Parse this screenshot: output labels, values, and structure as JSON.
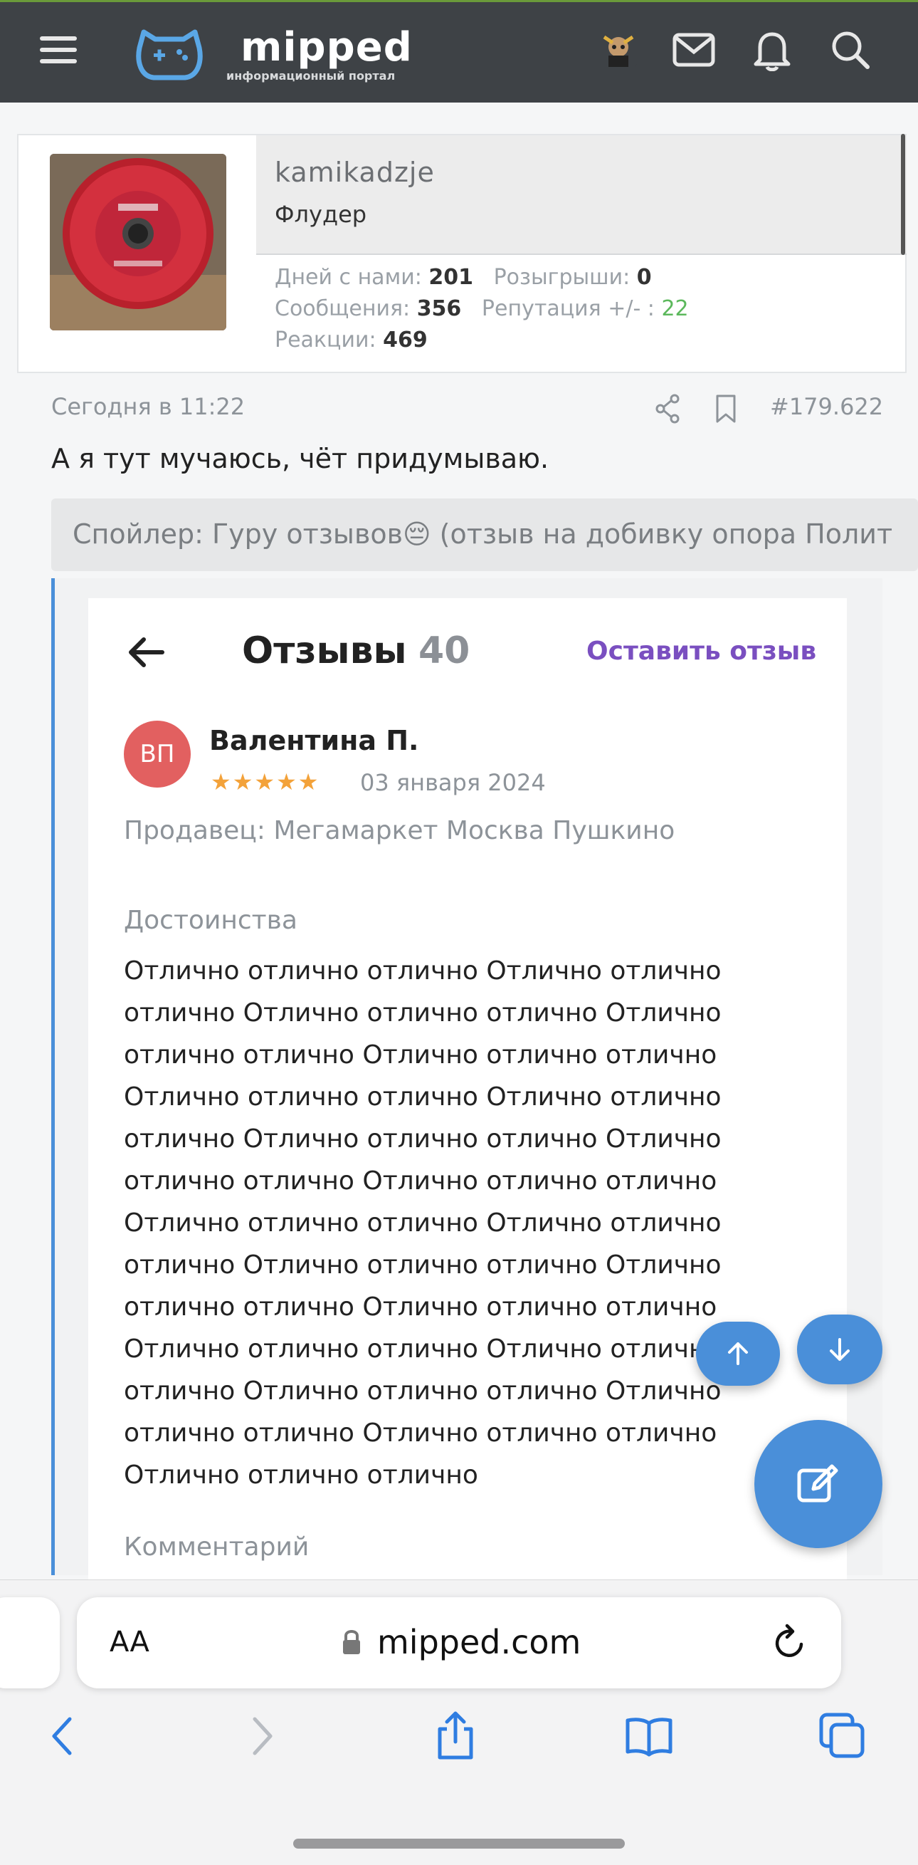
{
  "header": {
    "logo_text": "mipped",
    "logo_subtitle": "информационный портал",
    "icons": [
      "menu-icon",
      "gamepad-logo-icon",
      "user-avatar-icon",
      "mail-icon",
      "bell-icon",
      "search-icon"
    ]
  },
  "post": {
    "username": "kamikadzje",
    "user_title": "Флудер",
    "stats": {
      "days_label": "Дней с нами:",
      "days_value": "201",
      "giveaways_label": "Розыгрыши:",
      "giveaways_value": "0",
      "messages_label": "Сообщения:",
      "messages_value": "356",
      "reputation_label": "Репутация +/- :",
      "reputation_value": "22",
      "reactions_label": "Реакции:",
      "reactions_value": "469"
    },
    "timestamp": "Сегодня в 11:22",
    "post_number": "#179.622",
    "message": "А я тут мучаюсь, чёт придумываю.",
    "spoiler": "Спойлер: Гуру отзывов😔 (отзыв на добивку опора Полит"
  },
  "review": {
    "back_icon": "arrow-left-icon",
    "title": "Отзывы",
    "count": "40",
    "leave_review": "Оставить отзыв",
    "author_initials": "ВП",
    "author": "Валентина П.",
    "stars": "★★★★★",
    "rating": 5,
    "date": "03 января 2024",
    "seller": "Продавец: Мегамаркет Москва Пушкино",
    "pros_label": "Достоинства",
    "pros_text": "Отлично отлично отлично Отлично отлично\nотлично Отлично отлично отлично Отлично\nотлично отлично Отлично отлично отлично\nОтлично отлично отлично Отлично отлично\nотлично Отлично отлично отлично Отлично\nотлично отлично Отлично отлично отлично\nОтлично отлично отлично Отлично отлично\nотлично Отлично отлично отлично Отлично\nотлично отлично Отлично отлично отлично\nОтлично отлично отлично Отлично отлично\nотлично Отлично отлично отлично Отлично\nотлично отлично Отлично отлично отлично\nОтлично отлично отлично",
    "comment_label": "Комментарий"
  },
  "browser": {
    "text_size": "AA",
    "url": "mipped.com"
  },
  "colors": {
    "header_bg": "#3e4246",
    "accent_blue": "#4a8fd9",
    "link_purple": "#7a4fc0",
    "star_orange": "#f3a23a",
    "reputation_green": "#5cb85c"
  }
}
